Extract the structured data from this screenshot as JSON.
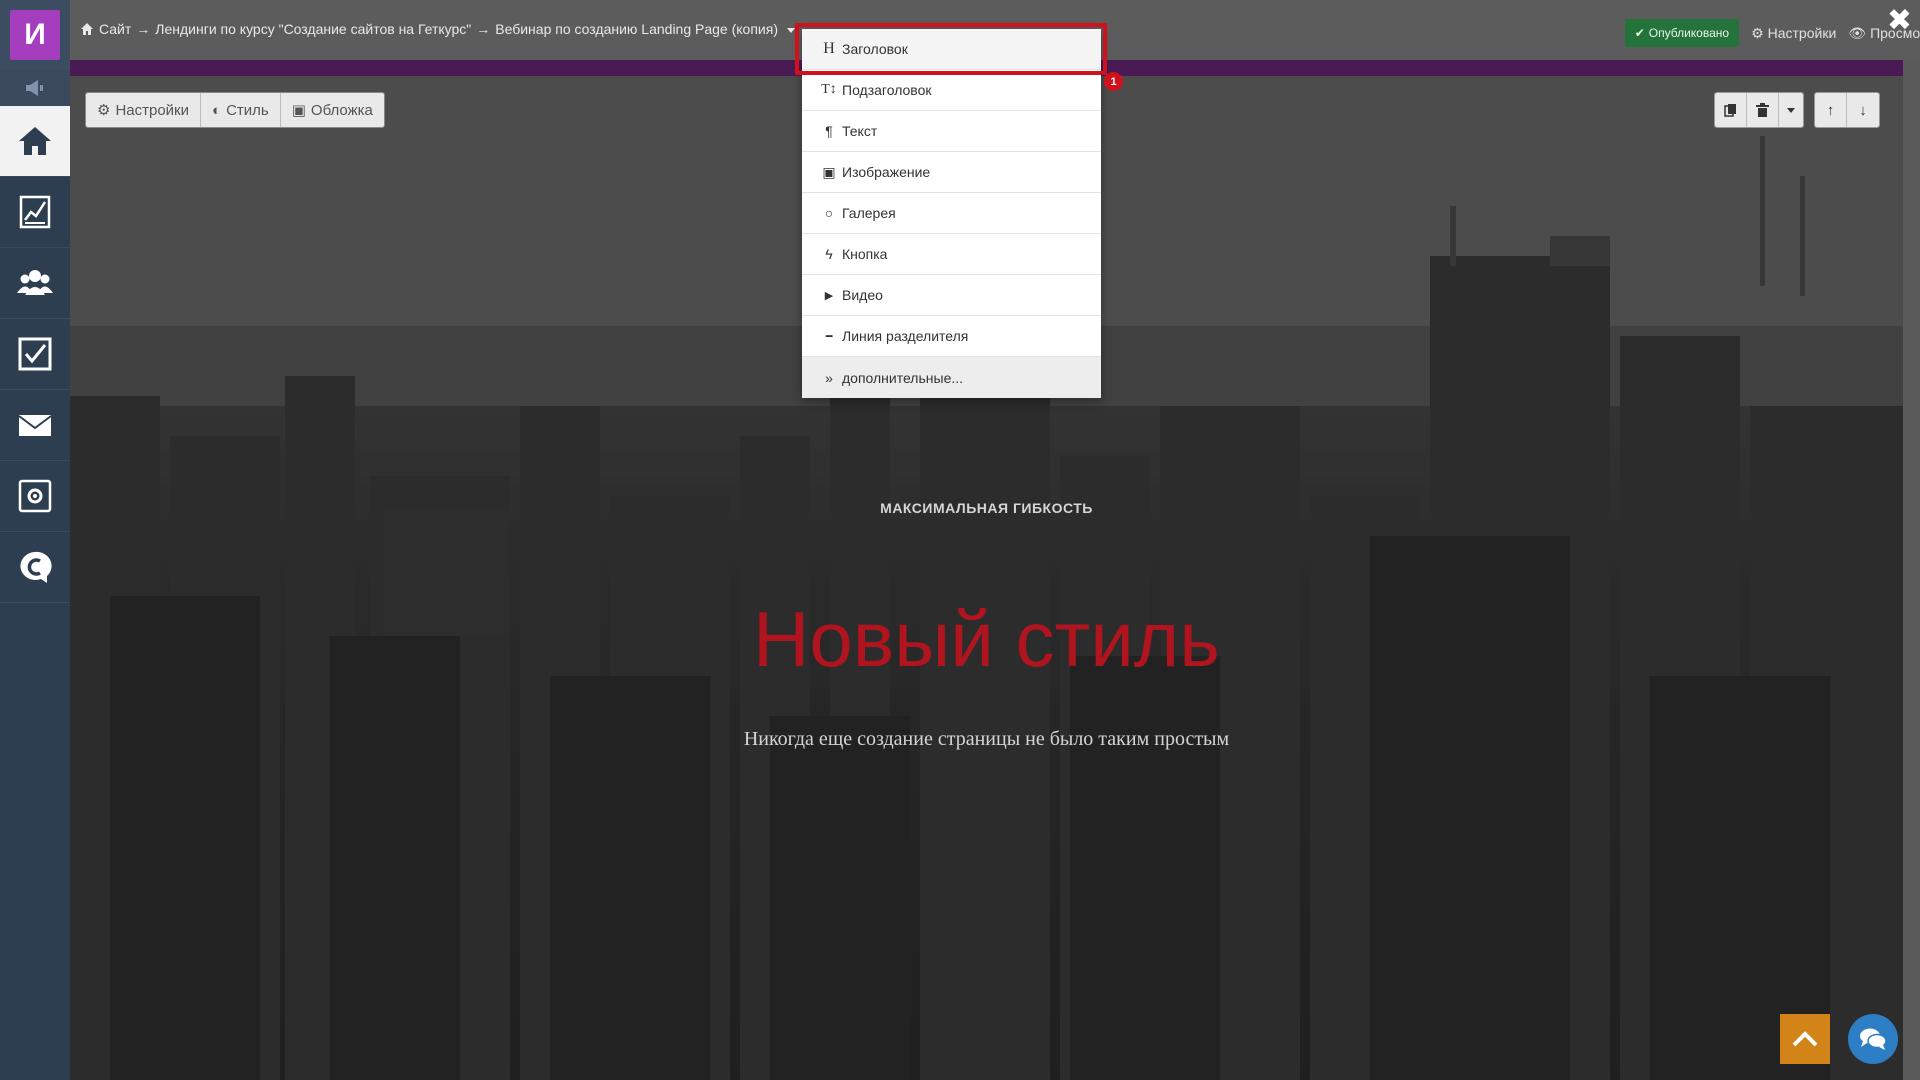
{
  "sidebar": {
    "logo_letter": "И",
    "items": [
      {
        "icon": "home-icon",
        "active": true
      },
      {
        "icon": "chart-icon",
        "active": false
      },
      {
        "icon": "users-icon",
        "active": false
      },
      {
        "icon": "tasks-checkbox-icon",
        "active": false
      },
      {
        "icon": "mail-icon",
        "active": false
      },
      {
        "icon": "settings-panel-icon",
        "active": false
      },
      {
        "icon": "chat-c-icon",
        "active": false
      }
    ]
  },
  "topbar": {
    "breadcrumb": {
      "part1": "Сайт",
      "sep": "→",
      "part2": "Лендинги по курсу \"Создание сайтов на Геткурс\"",
      "part3": "Вебинар по созданию Landing Page (копия)"
    },
    "published_label": "Опубликовано",
    "settings_label": "Настройки",
    "preview_label": "Просмотр",
    "close_label": "✖"
  },
  "block_toolbar": {
    "settings": "Настройки",
    "style": "Стиль",
    "cover": "Обложка"
  },
  "hero": {
    "eyebrow": "МАКСИМАЛЬНАЯ ГИБКОСТЬ",
    "headline": "Новый стиль",
    "subline": "Никогда еще создание страницы не было таким простым"
  },
  "dropdown": {
    "items": [
      {
        "icon": "H",
        "label": "Заголовок"
      },
      {
        "icon": "T↕",
        "label": "Подзаголовок"
      },
      {
        "icon": "¶",
        "label": "Текст"
      },
      {
        "icon": "▣",
        "label": "Изображение"
      },
      {
        "icon": "○",
        "label": "Галерея"
      },
      {
        "icon": "ϟ",
        "label": "Кнопка"
      },
      {
        "icon": "▶",
        "label": "Видео"
      },
      {
        "icon": "━",
        "label": "Линия разделителя"
      },
      {
        "icon": "»",
        "label": "дополнительные..."
      }
    ],
    "badge": "1"
  },
  "colors": {
    "sidebar_bg": "#2e3e51",
    "logo": "#a53dbf",
    "published": "#24733b",
    "headline": "#b0141e",
    "highlight": "#d0111b",
    "scroll_top": "#d28419",
    "chat": "#2d7ec4"
  }
}
